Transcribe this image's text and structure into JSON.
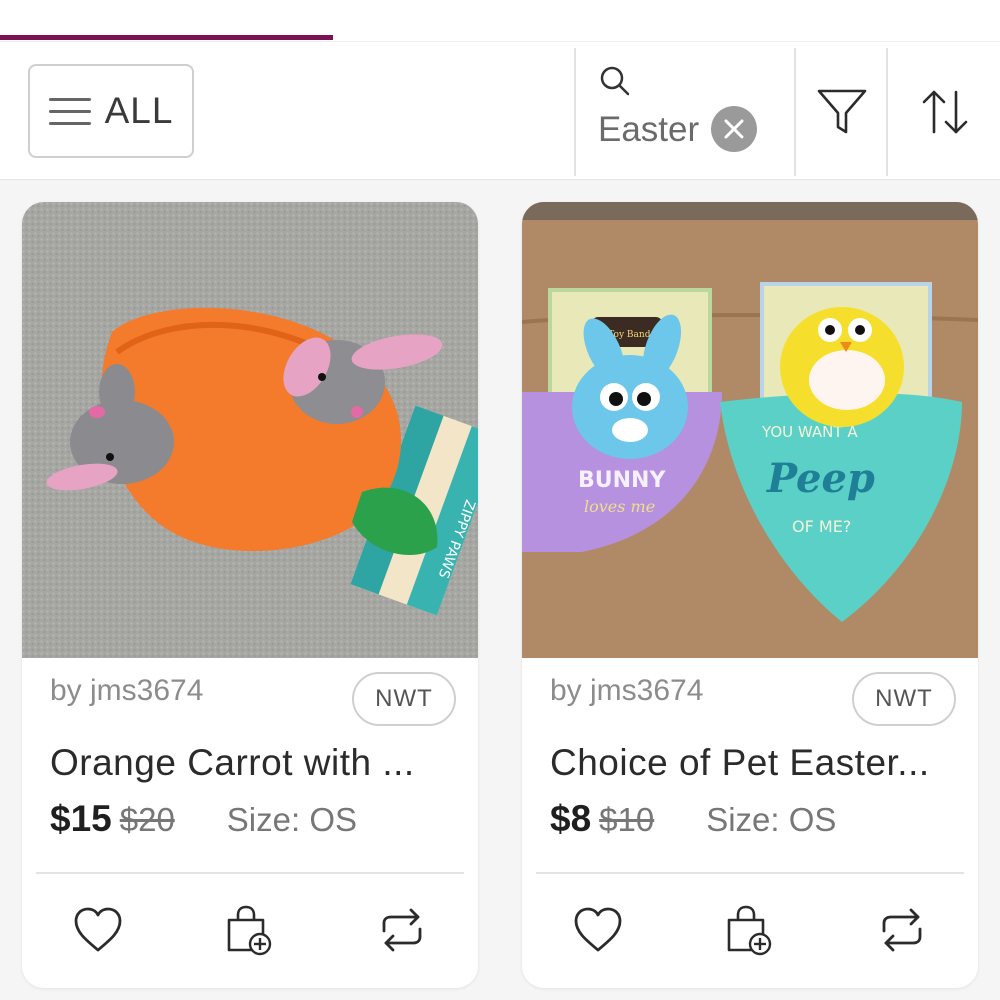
{
  "progress": 0.333,
  "filter_bar": {
    "category_label": "ALL",
    "search_term": "Easter"
  },
  "listings": [
    {
      "seller": "by jms3674",
      "condition_badge": "NWT",
      "title": "Orange Carrot with ...",
      "price": "$15",
      "original_price": "$20",
      "size": "Size: OS",
      "image_text": [
        "ZIPPY PAWS"
      ]
    },
    {
      "seller": "by jms3674",
      "condition_badge": "NWT",
      "title": "Choice of Pet Easter...",
      "price": "$8",
      "original_price": "$10",
      "size": "Size: OS",
      "image_text": [
        "Dog Toy Bandana",
        "BUNNY",
        "loves me",
        "YOU WANT A",
        "Peep",
        "OF ME?"
      ]
    }
  ],
  "colors": {
    "accent": "#7a1356",
    "icon": "#2b2b2b",
    "badge_border": "#cfcfcf",
    "clear_button": "#9a9a9a"
  }
}
